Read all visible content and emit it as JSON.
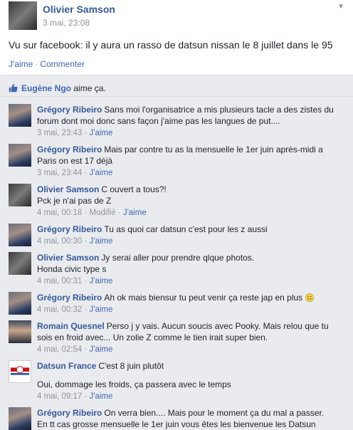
{
  "post": {
    "author": "Olivier Samson",
    "time": "3 mai, 23:08",
    "text": "Vu sur facebook: il y aura un rasso de datsun nissan le 8 juillet dans le 95",
    "like_label": "J'aime",
    "separator": "·",
    "comment_label": "Commenter"
  },
  "likes": {
    "name": "Eugène Ngo",
    "suffix": "aime ça."
  },
  "comments": [
    {
      "author": "Grégory Ribeiro",
      "lines": [
        "Sans moi l'organisatrice a mis plusieurs tacle a des zistes du",
        "forum dont moi donc sans façon j'aime pas les langues de put...."
      ],
      "time": "3 mai, 23:43",
      "like": "J'aime"
    },
    {
      "author": "Grégory Ribeiro",
      "lines": [
        "Mais par contre tu as la mensuelle le 1er juin après-midi a",
        "Paris on est 17 déjà"
      ],
      "time": "3 mai, 23:44",
      "like": "J'aime"
    },
    {
      "author": "Olivier Samson",
      "lines": [
        "C ouvert a tous?!",
        "Pck je n'ai pas de Z"
      ],
      "time": "4 mai, 00:18",
      "modified": "Modifié",
      "like": "J'aime"
    },
    {
      "author": "Grégory Ribeiro",
      "lines": [
        "Tu as quoi car datsun c'est pour les z aussi"
      ],
      "time": "4 mai, 00:30",
      "like": "J'aime"
    },
    {
      "author": "Olivier Samson",
      "lines": [
        "Jy serai aller pour prendre qlque photos.",
        "Honda civic type s"
      ],
      "time": "4 mai, 00:31",
      "like": "J'aime"
    },
    {
      "author": "Grégory Ribeiro",
      "lines": [
        "Ah ok mais biensur tu peut venir ça reste jap en plus"
      ],
      "time": "4 mai, 00:32",
      "like": "J'aime"
    },
    {
      "author": "Romain Quesnel",
      "lines": [
        "Perso j y vais. Aucun soucis avec Pooky. Mais relou que tu",
        "sois en froid avec... Un zolie Z comme le tien irait super bien."
      ],
      "time": "4 mai, 02:54",
      "like": "J'aime"
    },
    {
      "author": "Datsun France",
      "lines": [
        "C'est 8 juin plutôt",
        "",
        "Oui, dommage les froids, ça passera avec le temps"
      ],
      "time": "4 mai, 09:17",
      "like": "J'aime"
    },
    {
      "author": "Grégory Ribeiro",
      "lines": [
        "On verra bien.... Mais pour le moment ça du mal a passer.",
        "En tt cas grosse mensuelle le 1er juin vous êtes les bienvenue les Datsun"
      ],
      "time": "",
      "like": ""
    }
  ],
  "colors": {
    "link": "#4267b2",
    "name": "#365899",
    "meta": "#90949c",
    "background": "#e9ebee"
  },
  "icons": {
    "like": "thumbs-up-icon",
    "menu": "chevron-down-icon",
    "emoji": "smiley-icon"
  }
}
